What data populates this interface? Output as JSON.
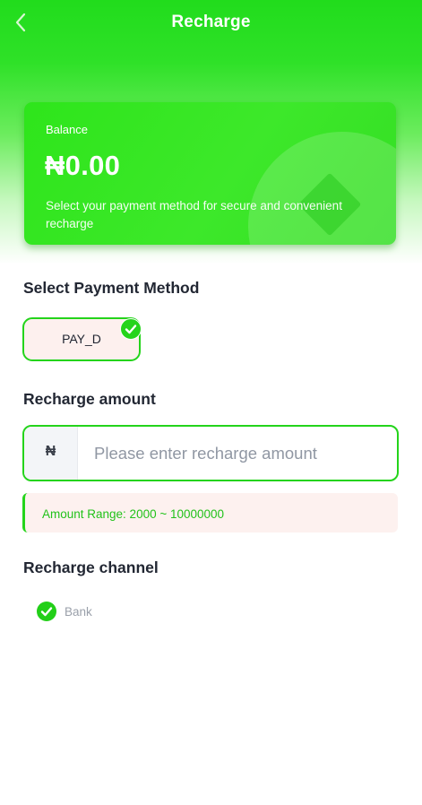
{
  "header": {
    "title": "Recharge",
    "back_icon": "chevron-left-icon"
  },
  "balance_card": {
    "label": "Balance",
    "amount": "₦0.00",
    "note": "Select your payment method for secure and convenient recharge"
  },
  "payment_method": {
    "title": "Select Payment Method",
    "options": [
      {
        "label": "PAY_D",
        "selected": true
      }
    ]
  },
  "amount": {
    "title": "Recharge amount",
    "currency_symbol": "₦",
    "value": "",
    "placeholder": "Please enter recharge amount",
    "range_text": "Amount Range: 2000 ~ 10000000"
  },
  "channel": {
    "title": "Recharge channel",
    "options": [
      {
        "label": "Bank",
        "selected": true
      }
    ]
  },
  "colors": {
    "accent": "#24d41b",
    "note_background": "#fdf1ef",
    "range_text": "#22c21a"
  }
}
